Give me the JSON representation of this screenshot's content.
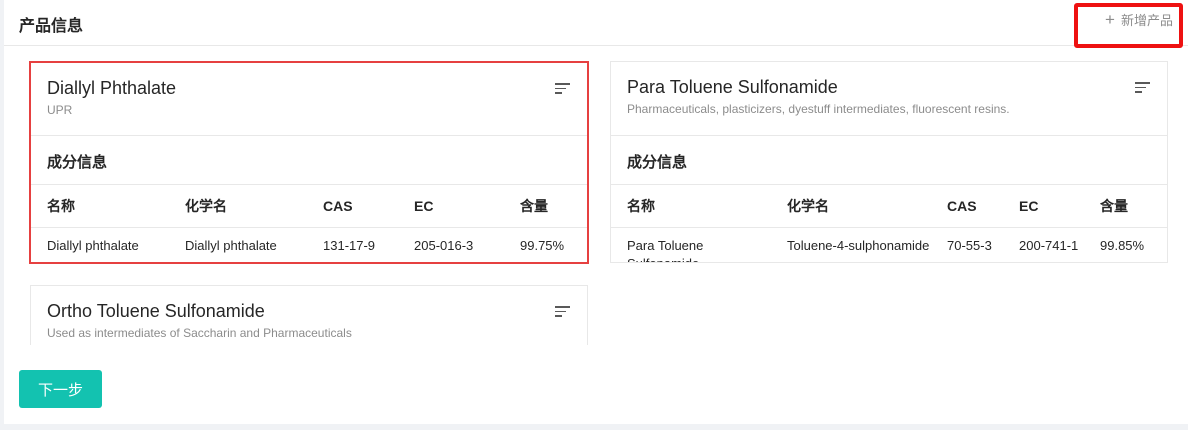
{
  "header": {
    "title": "产品信息",
    "add_label": "新增产品"
  },
  "section_title": "成分信息",
  "columns": [
    "名称",
    "化学名",
    "CAS",
    "EC",
    "含量"
  ],
  "cards": [
    {
      "title": "Diallyl Phthalate",
      "subtitle": "UPR",
      "rows": [
        [
          "Diallyl phthalate",
          "Diallyl phthalate",
          "131-17-9",
          "205-016-3",
          "99.75%"
        ]
      ]
    },
    {
      "title": "Para Toluene Sulfonamide",
      "subtitle": "Pharmaceuticals, plasticizers, dyestuff intermediates, fluorescent resins.",
      "rows": [
        [
          "Para Toluene Sulfonamide",
          "Toluene-4-sulphonamide",
          "70-55-3",
          "200-741-1",
          "99.85%"
        ]
      ]
    },
    {
      "title": "Ortho Toluene Sulfonamide",
      "subtitle": "Used as intermediates of Saccharin and Pharmaceuticals"
    }
  ],
  "footer": {
    "next_label": "下一步"
  },
  "colors": {
    "accent": "#13c2b0",
    "highlight": "#ee1111",
    "selected_border": "#e64040"
  }
}
